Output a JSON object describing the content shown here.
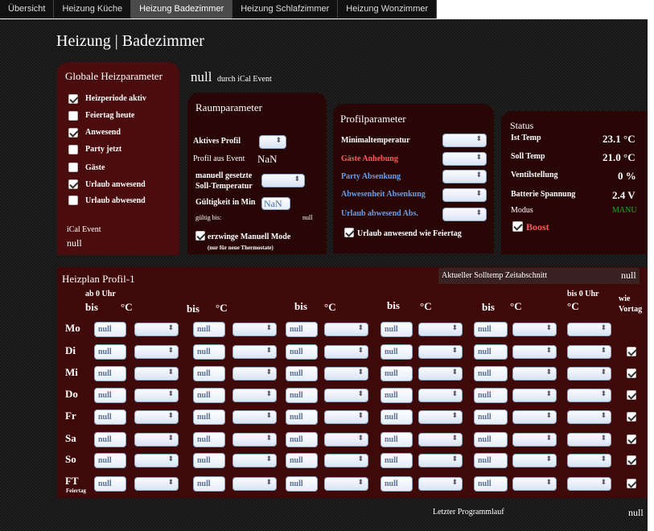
{
  "tabs": [
    "Übersicht",
    "Heizung Küche",
    "Heizung Badezimmer",
    "Heizung Schlafzimmer",
    "Heizung Wonzimmer"
  ],
  "page_title": "Heizung | Badezimmer",
  "event_line": {
    "value": "null",
    "suffix": "durch iCal Event"
  },
  "global": {
    "title": "Globale Heizparameter",
    "items": [
      {
        "label": "Heizperiode aktiv",
        "checked": true
      },
      {
        "label": "Feiertag heute",
        "checked": false
      },
      {
        "label": "Anwesend",
        "checked": true
      },
      {
        "label": "Party jetzt",
        "checked": false
      },
      {
        "label": "Gäste",
        "checked": false
      },
      {
        "label": "Urlaub anwesend",
        "checked": true
      },
      {
        "label": "Urlaub abwesend",
        "checked": false
      }
    ],
    "ical_label": "iCal Event",
    "ical_value": "null"
  },
  "room": {
    "title": "Raumparameter",
    "active_profile": "Aktives Profil",
    "profile_event": "Profil aus Event",
    "profile_event_value": "NaN",
    "manual_l1": "manuell gesetzte",
    "manual_l2": "Soll-Temperatur",
    "validity": "Gültigkeit in Min",
    "validity_value": "NaN",
    "valid_until": "gültig bis:",
    "valid_until_value": "null",
    "force_manual": "erzwinge Manuell Mode",
    "force_manual_note": "(nur für neue Thermostate)"
  },
  "profile": {
    "title": "Profilparameter",
    "rows": [
      "Minimaltemperatur",
      "Gäste Anhebung",
      "Party Absenkung",
      "Abwesenheit Absenkung",
      "Urlaub abwesend Abs."
    ],
    "holiday_label": "Urlaub anwesend wie Feiertag"
  },
  "status": {
    "title": "Status",
    "ist_label": "Ist Temp",
    "ist_value": "23.1 °C",
    "soll_label": "Soll Temp",
    "soll_value": "21.0 °C",
    "ventil_label": "Ventilstellung",
    "ventil_value": "0 %",
    "batt_label": "Batterie Spannung",
    "batt_value": "2.4 V",
    "mode_label": "Modus",
    "mode_value": "MANU",
    "boost_label": "Boost"
  },
  "plan": {
    "title": "Heizplan Profil-1",
    "current_label": "Aktueller Solltemp Zeitabschnitt",
    "current_value": "null",
    "from0": "ab 0 Uhr",
    "to24": "bis 0 Uhr",
    "bis": "bis",
    "deg": "°C",
    "wie1": "wie",
    "wie2": "Vortag",
    "days": [
      "Mo",
      "Di",
      "Mi",
      "Do",
      "Fr",
      "Sa",
      "So",
      "FT"
    ],
    "ft_sub": "Feiertag",
    "cell": "null",
    "last_run_label": "Letzter Programmlauf",
    "last_run_value": "null"
  }
}
